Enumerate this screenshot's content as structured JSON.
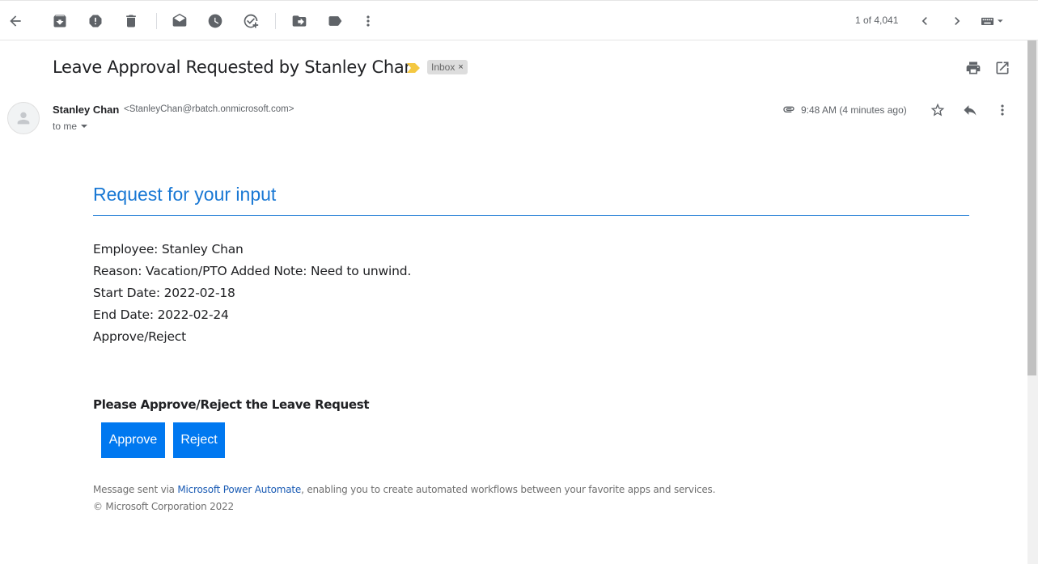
{
  "toolbar": {
    "pager_text": "1 of 4,041"
  },
  "email": {
    "subject": "Leave Approval Requested by Stanley Chan",
    "label": "Inbox",
    "label_close": "×",
    "sender_name": "Stanley Chan",
    "sender_email": "<StanleyChan@rbatch.onmicrosoft.com>",
    "recipient": "to me",
    "timestamp": "9:48 AM (4 minutes ago)"
  },
  "body": {
    "title": "Request for your input",
    "lines": [
      "Employee: Stanley Chan",
      "Reason: Vacation/PTO Added Note: Need to unwind.",
      "Start Date: 2022-02-18",
      "End Date: 2022-02-24",
      "Approve/Reject"
    ],
    "prompt": "Please Approve/Reject the Leave Request",
    "approve_label": "Approve",
    "reject_label": "Reject",
    "footer_prefix": "Message sent via ",
    "footer_link": "Microsoft Power Automate",
    "footer_suffix": ", enabling you to create automated workflows between your favorite apps and services.",
    "copyright": "© Microsoft Corporation 2022"
  },
  "colors": {
    "accent": "#1978d4",
    "button": "#0078f0",
    "link": "#1a5bb4",
    "importance_marker": "#f4c842"
  }
}
